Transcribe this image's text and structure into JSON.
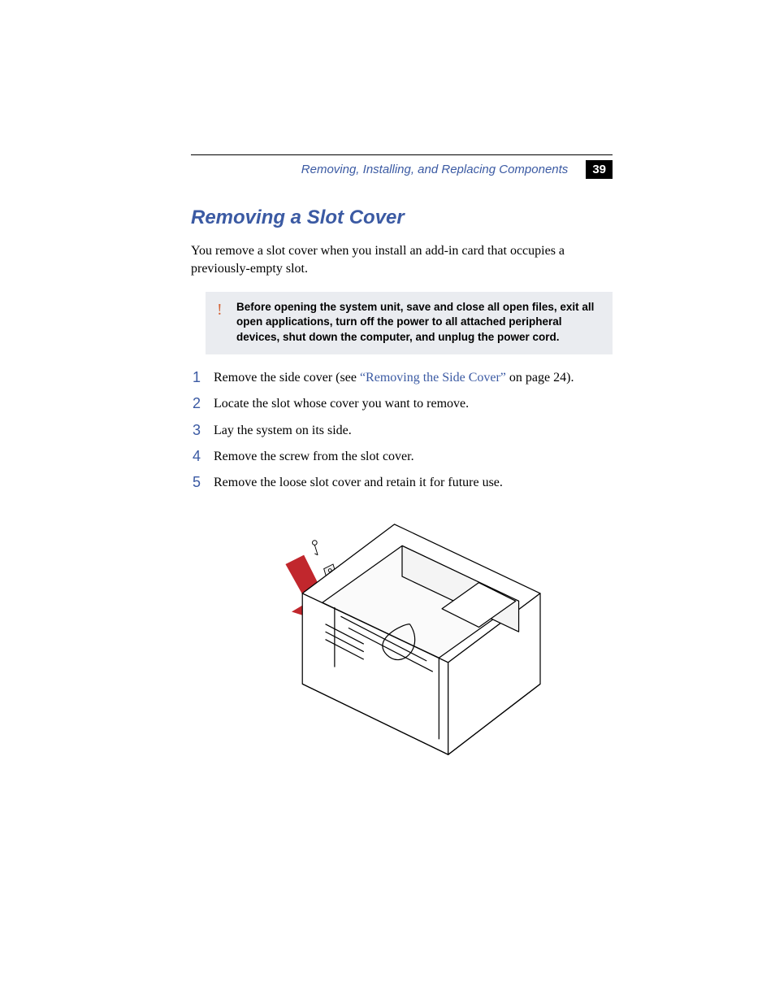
{
  "header": {
    "chapter_title": "Removing, Installing, and Replacing Components",
    "page_number": "39"
  },
  "section": {
    "title": "Removing a Slot Cover",
    "intro": "You remove a slot cover when you install an add-in card that occupies a previously-empty slot."
  },
  "warning": {
    "icon": "!",
    "text": "Before opening the system unit, save and close all open files, exit all open applications, turn off the power to all attached peripheral devices, shut down the computer, and unplug the power cord."
  },
  "steps": [
    {
      "pre": "Remove the side cover (see ",
      "xref": "“Removing the Side Cover”",
      "post": " on page 24)."
    },
    {
      "text": "Locate the slot whose cover you want to remove."
    },
    {
      "text": "Lay the system on its side."
    },
    {
      "text": "Remove the screw from the slot cover."
    },
    {
      "text": "Remove the loose slot cover and retain it for future use."
    }
  ],
  "figure": {
    "alt": "Isometric line drawing of an open computer chassis on its side with a red arrow indicating removal of a slot cover bracket and screw."
  }
}
